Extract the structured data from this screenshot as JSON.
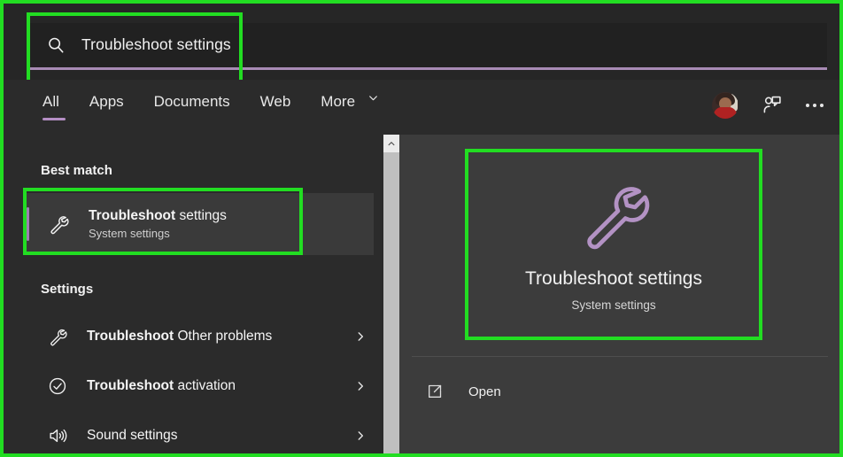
{
  "search": {
    "icon": "search-icon",
    "value": "Troubleshoot settings",
    "placeholder": "Type here to search"
  },
  "tabs": [
    {
      "label": "All",
      "active": true
    },
    {
      "label": "Apps",
      "active": false
    },
    {
      "label": "Documents",
      "active": false
    },
    {
      "label": "Web",
      "active": false
    },
    {
      "label": "More",
      "active": false,
      "icon": "chevron-down-icon"
    }
  ],
  "header_actions": {
    "avatar": "user-avatar",
    "feedback_icon": "feedback-icon",
    "more_icon": "ellipsis-icon"
  },
  "results": {
    "best_match": {
      "header": "Best match",
      "icon": "wrench-icon",
      "title_bold": "Troubleshoot",
      "title_normal": " settings",
      "subtitle": "System settings",
      "selected": true
    },
    "settings": {
      "header": "Settings",
      "items": [
        {
          "icon": "wrench-icon",
          "label_bold": "Troubleshoot",
          "label_normal": " Other problems",
          "chevron": "chevron-right-icon"
        },
        {
          "icon": "check-circle-icon",
          "label_bold": "Troubleshoot",
          "label_normal": " activation",
          "chevron": "chevron-right-icon"
        },
        {
          "icon": "speaker-icon",
          "label_bold": "",
          "label_normal": "Sound settings",
          "chevron": "chevron-right-icon"
        }
      ]
    }
  },
  "scrollbar": {
    "up_arrow_icon": "chevron-up-icon"
  },
  "preview": {
    "icon": "wrench-icon",
    "title": "Troubleshoot settings",
    "subtitle": "System settings",
    "actions": [
      {
        "icon": "open-external-icon",
        "label": "Open"
      }
    ]
  },
  "colors": {
    "accent_purple": "#b392c4",
    "underline_purple": "#a88bb5",
    "annotation_green": "#22dd22",
    "panel_left_bg": "#2b2b2b",
    "panel_right_bg": "#3c3c3c",
    "search_bg": "#212121",
    "selected_row_bg": "#3a3a3a"
  }
}
